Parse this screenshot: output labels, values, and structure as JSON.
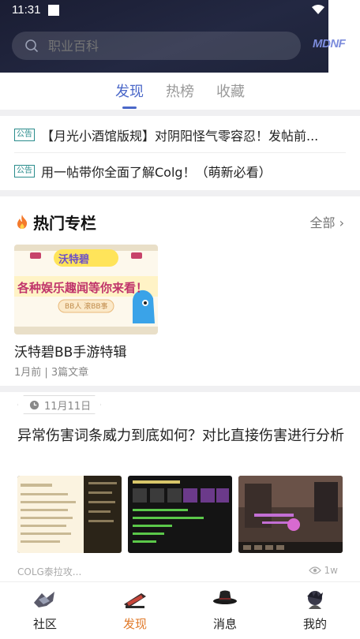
{
  "status": {
    "time": "11:31"
  },
  "search": {
    "placeholder": "职业百科"
  },
  "logo": {
    "text": "MDNF"
  },
  "tabs": [
    {
      "label": "发现",
      "active": true
    },
    {
      "label": "热榜",
      "active": false
    },
    {
      "label": "收藏",
      "active": false
    }
  ],
  "notices": [
    {
      "tag": "公告",
      "text": "【月光小酒馆版规】对阴阳怪气零容忍！发帖前..."
    },
    {
      "tag": "公告",
      "text": "用一帖带你全面了解Colg！（萌新必看）"
    }
  ],
  "hot": {
    "title": "热门专栏",
    "all_label": "全部",
    "cards": [
      {
        "title": "沃特碧BB手游特辑",
        "meta": "1月前 | 3篇文章",
        "banner_title": "沃特碧",
        "banner_line": "各种娱乐趣闻等你来看！",
        "banner_tag": "BB人 滚BB事"
      }
    ]
  },
  "post": {
    "date": "11月11日",
    "title": "异常伤害词条威力到底如何？对比直接伤害进行分析",
    "source": "COLG泰拉攻...",
    "views": "1w"
  },
  "nav": [
    {
      "label": "社区",
      "active": false
    },
    {
      "label": "发现",
      "active": true
    },
    {
      "label": "消息",
      "active": false
    },
    {
      "label": "我的",
      "active": false
    }
  ],
  "colors": {
    "accent": "#4a67c8",
    "nav_active": "#e07a2a",
    "notice_tag": "#2a8c8c"
  }
}
